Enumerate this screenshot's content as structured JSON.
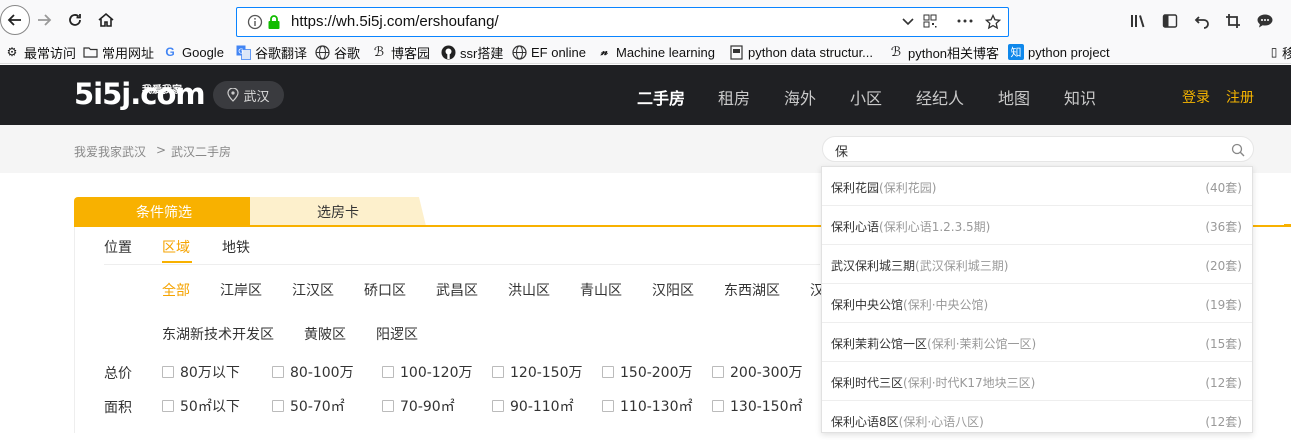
{
  "browser": {
    "url": "https://wh.5i5j.com/ershoufang/",
    "bookmarks": [
      "最常访问",
      "常用网址",
      "Google",
      "谷歌翻译",
      "谷歌",
      "博客园",
      "ssr搭建",
      "EF online",
      "Machine learning",
      "python data structur...",
      "python相关博客",
      "python project",
      "移"
    ]
  },
  "site": {
    "logo": "5i5j.com",
    "logo_sub": "我爱我家",
    "city": "武汉",
    "nav": [
      "二手房",
      "租房",
      "海外",
      "小区",
      "经纪人",
      "地图",
      "知识"
    ],
    "login": "登录",
    "register": "注册"
  },
  "breadcrumb": {
    "home": "我爱我家武汉",
    "sep": ">",
    "current": "武汉二手房"
  },
  "search": {
    "value": "保"
  },
  "filter": {
    "tab_active": "条件筛选",
    "tab_other": "选房卡",
    "subtabs": [
      "位置",
      "区域",
      "地铁"
    ],
    "districts_row1": [
      "全部",
      "江岸区",
      "江汉区",
      "硚口区",
      "武昌区",
      "洪山区",
      "青山区",
      "汉阳区",
      "东西湖区",
      "汉"
    ],
    "districts_row2": [
      "东湖新技术开发区",
      "黄陂区",
      "阳逻区"
    ],
    "price_label": "总价",
    "price_options": [
      "80万以下",
      "80-100万",
      "100-120万",
      "120-150万",
      "150-200万",
      "200-300万"
    ],
    "area_label": "面积",
    "area_options": [
      "50㎡以下",
      "50-70㎡",
      "70-90㎡",
      "90-110㎡",
      "110-130㎡",
      "130-150㎡"
    ]
  },
  "suggestions": [
    {
      "name": "保利花园",
      "alias": "(保利花园)",
      "count": "(40套)"
    },
    {
      "name": "保利心语",
      "alias": "(保利心语1.2.3.5期)",
      "count": "(36套)"
    },
    {
      "name": "武汉保利城三期",
      "alias": "(武汉保利城三期)",
      "count": "(20套)"
    },
    {
      "name": "保利中央公馆",
      "alias": "(保利·中央公馆)",
      "count": "(19套)"
    },
    {
      "name": "保利茉莉公馆一区",
      "alias": "(保利·茉莉公馆一区)",
      "count": "(15套)"
    },
    {
      "name": "保利时代三区",
      "alias": "(保利·时代K17地块三区)",
      "count": "(12套)"
    },
    {
      "name": "保利心语8区",
      "alias": "(保利·心语八区)",
      "count": "(12套)"
    }
  ],
  "colors": {
    "accent": "#f8b100",
    "header_bg": "#1f2023",
    "focus_blue": "#0a84ff"
  }
}
